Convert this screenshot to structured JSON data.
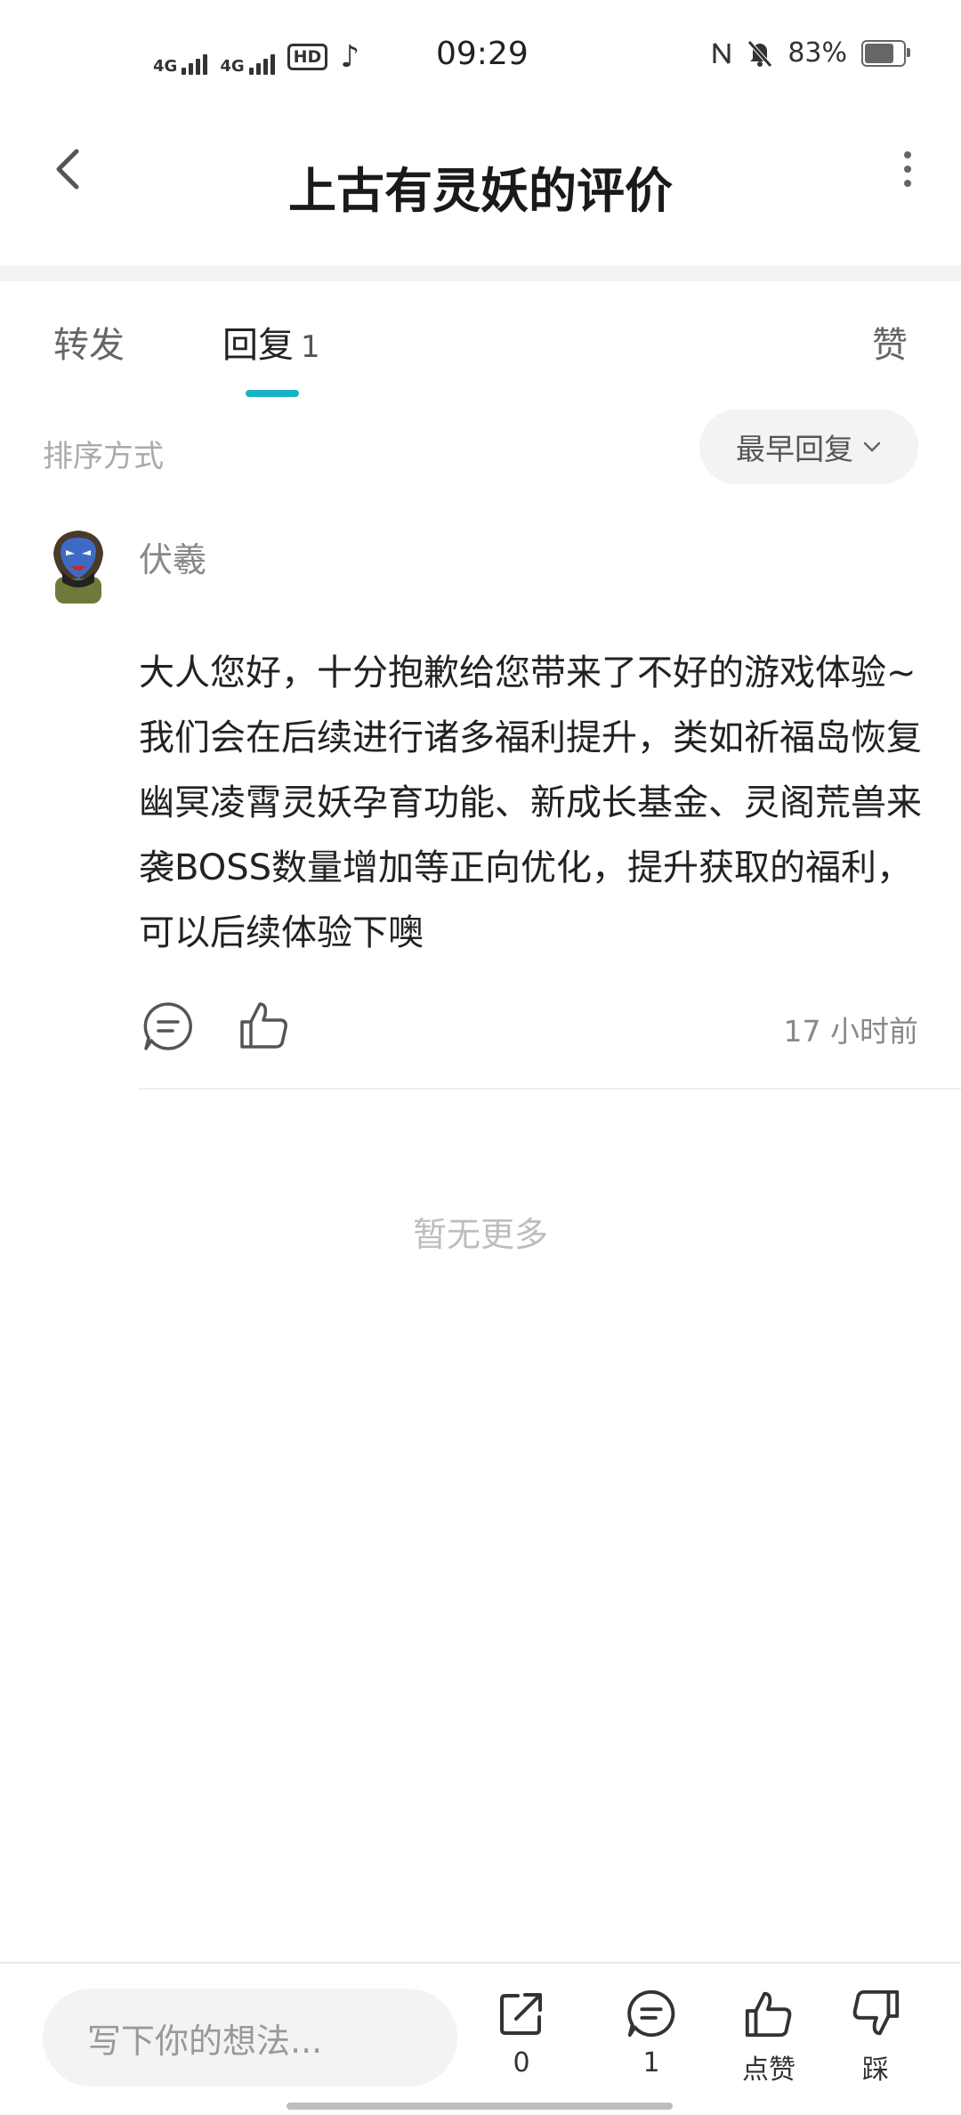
{
  "status_bar": {
    "network1": "4G",
    "network2": "4G",
    "hd": "HD",
    "time": "09:29",
    "battery": "83%",
    "battery_level": 0.83
  },
  "header": {
    "title": "上古有灵妖的评价"
  },
  "tabs": [
    {
      "label": "转发"
    },
    {
      "label": "回复",
      "count": "1"
    },
    {
      "label": "赞"
    }
  ],
  "sort": {
    "label": "排序方式",
    "selected": "最早回复"
  },
  "comment": {
    "username": "伏羲",
    "text": "大人您好，十分抱歉给您带来了不好的游戏体验~我们会在后续进行诸多福利提升，类如祈福岛恢复幽冥凌霄灵妖孕育功能、新成长基金、灵阁荒兽来袭BOSS数量增加等正向优化，提升获取的福利，可以后续体验下噢",
    "time": "17 小时前"
  },
  "no_more": "暂无更多",
  "bottom_bar": {
    "input_placeholder": "写下你的想法...",
    "share_count": "0",
    "reply_count": "1",
    "like_label": "点赞",
    "dislike_label": "踩"
  },
  "colors": {
    "accent": "#19b3c3",
    "background": "#ffffff",
    "band": "#f3f3f3"
  }
}
